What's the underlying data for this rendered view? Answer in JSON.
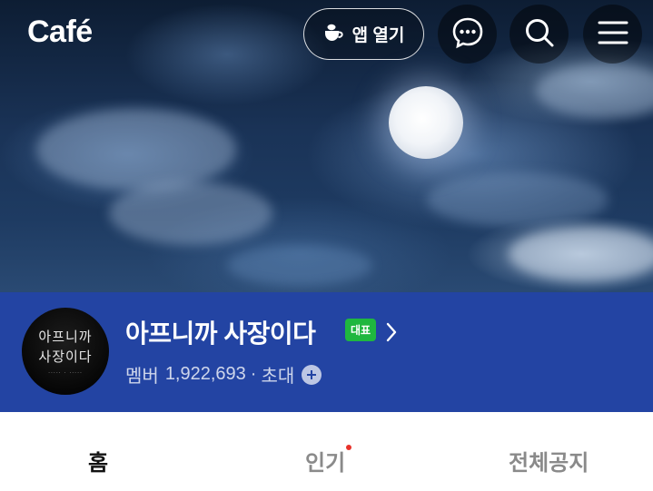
{
  "header": {
    "logo_text": "Café",
    "app_open_label": "앱 열기",
    "icons": [
      "cup-icon",
      "chat-icon",
      "search-icon",
      "menu-icon"
    ]
  },
  "banner": {
    "description": ""
  },
  "cafe": {
    "thumbnail_lines": [
      "아프니까",
      "사장이다"
    ],
    "name": "아프니까 사장이다",
    "badge": "대표",
    "member_label": "멤버",
    "member_count": "1,922,693",
    "separator": "·",
    "invite_label": "초대"
  },
  "tabs": [
    {
      "label": "홈",
      "active": true
    },
    {
      "label": "인기",
      "active": false,
      "new": true
    },
    {
      "label": "전체공지",
      "active": false
    }
  ],
  "colors": {
    "info_bar": "#2344a3",
    "badge": "#1fb73f",
    "new_dot": "#e8322b"
  }
}
